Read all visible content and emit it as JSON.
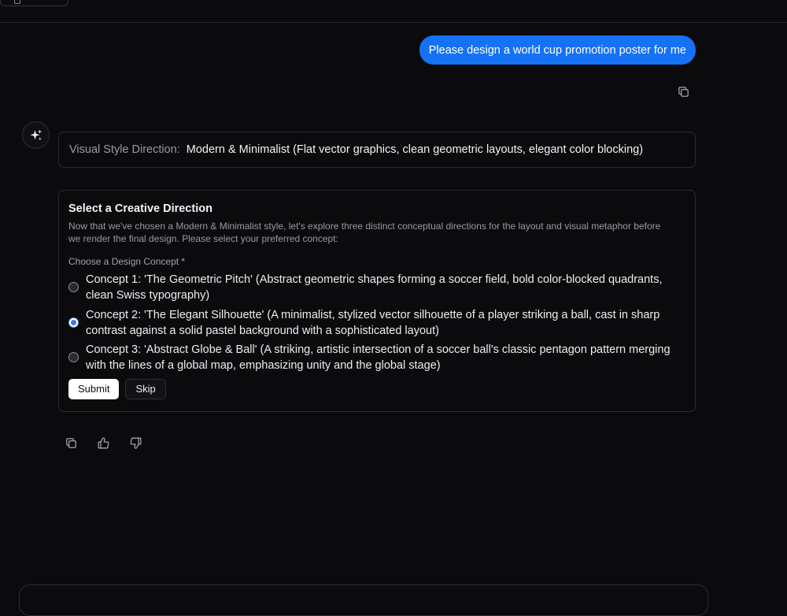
{
  "user_message": "Please design a world cup promotion poster for me",
  "style_direction": {
    "label": "Visual Style Direction:",
    "value": "Modern & Minimalist (Flat vector graphics, clean geometric layouts, elegant color blocking)"
  },
  "concept_form": {
    "title": "Select a Creative Direction",
    "description": "Now that we've chosen a Modern & Minimalist style, let's explore three distinct conceptual directions for the layout and visual metaphor before we render the final design. Please select your preferred concept:",
    "field_label": "Choose a Design Concept *",
    "options": [
      {
        "label": "Concept 1: 'The Geometric Pitch' (Abstract geometric shapes forming a soccer field, bold color-blocked quadrants, clean Swiss typography)",
        "selected": false
      },
      {
        "label": "Concept 2: 'The Elegant Silhouette' (A minimalist, stylized vector silhouette of a player striking a ball, cast in sharp contrast against a solid pastel background with a sophisticated layout)",
        "selected": true
      },
      {
        "label": "Concept 3: 'Abstract Globe & Ball' (A striking, artistic intersection of a soccer ball's classic pentagon pattern merging with the lines of a global map, emphasizing unity and the global stage)",
        "selected": false
      }
    ],
    "submit_label": "Submit",
    "skip_label": "Skip"
  },
  "icons": {
    "copy": "copy-icon",
    "thumbs_up": "thumbs-up-icon",
    "thumbs_down": "thumbs-down-icon",
    "avatar": "sparkle-icon"
  },
  "colors": {
    "background": "#0b0b0d",
    "user_bubble": "#1572f5",
    "radio_accent": "#3b7be6"
  }
}
